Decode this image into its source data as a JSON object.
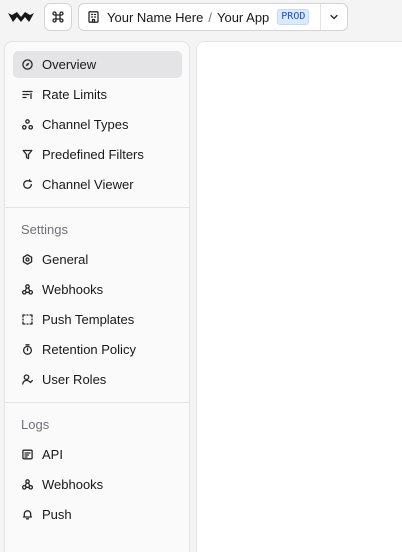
{
  "app": {
    "org_name": "Your Name Here",
    "separator": "/",
    "app_name": "Your App",
    "environment": "PROD"
  },
  "sidebar": {
    "main_items": [
      {
        "label": "Overview",
        "icon": "compass-icon",
        "active": true
      },
      {
        "label": "Rate Limits",
        "icon": "rate-limits-icon"
      },
      {
        "label": "Channel Types",
        "icon": "channel-types-icon"
      },
      {
        "label": "Predefined Filters",
        "icon": "filter-icon"
      },
      {
        "label": "Channel Viewer",
        "icon": "refresh-icon"
      }
    ],
    "settings": {
      "heading": "Settings",
      "items": [
        {
          "label": "General",
          "icon": "gear-icon"
        },
        {
          "label": "Webhooks",
          "icon": "webhook-icon"
        },
        {
          "label": "Push Templates",
          "icon": "template-icon"
        },
        {
          "label": "Retention Policy",
          "icon": "timer-icon"
        },
        {
          "label": "User Roles",
          "icon": "user-roles-icon"
        }
      ]
    },
    "logs": {
      "heading": "Logs",
      "items": [
        {
          "label": "API",
          "icon": "api-log-icon"
        },
        {
          "label": "Webhooks",
          "icon": "webhook-icon"
        },
        {
          "label": "Push",
          "icon": "bell-icon"
        }
      ]
    }
  }
}
